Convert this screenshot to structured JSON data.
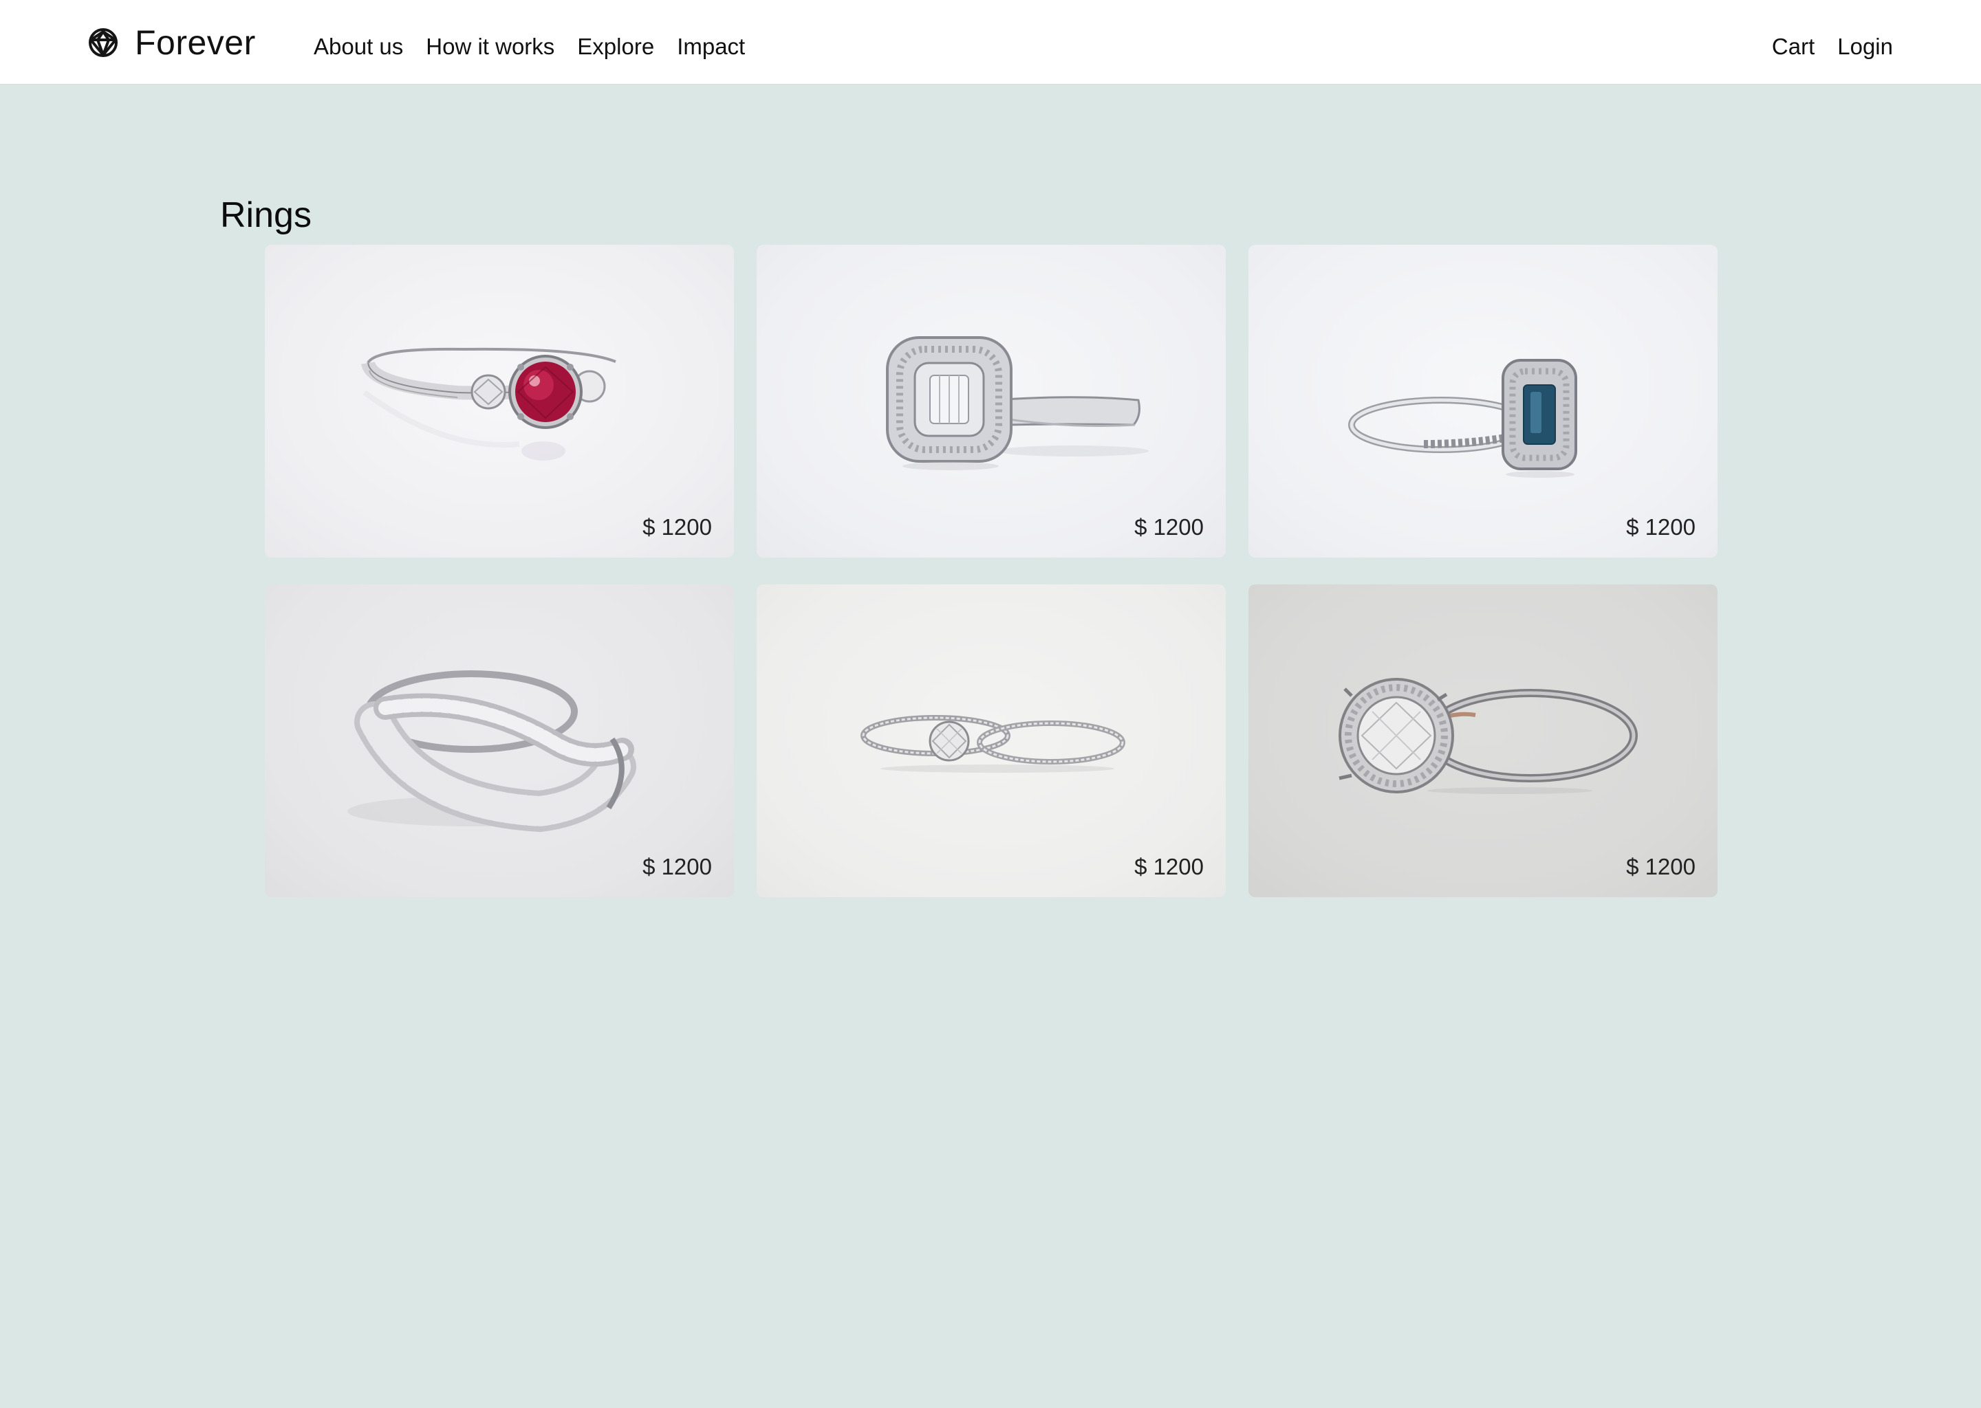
{
  "header": {
    "brand": {
      "name": "Forever",
      "icon": "diamond-icon"
    },
    "nav_left": [
      {
        "label": "About us"
      },
      {
        "label": "How it works"
      },
      {
        "label": "Explore"
      },
      {
        "label": "Impact"
      }
    ],
    "nav_right": [
      {
        "label": "Cart"
      },
      {
        "label": "Login"
      }
    ]
  },
  "main": {
    "section_title": "Rings",
    "products": [
      {
        "price": "$ 1200",
        "image": "ruby-three-stone-ring"
      },
      {
        "price": "$ 1200",
        "image": "cushion-halo-diamond-ring"
      },
      {
        "price": "$ 1200",
        "image": "sapphire-emerald-cut-halo-ring"
      },
      {
        "price": "$ 1200",
        "image": "crossover-pave-band-ring"
      },
      {
        "price": "$ 1200",
        "image": "solitaire-bridal-set"
      },
      {
        "price": "$ 1200",
        "image": "round-halo-engagement-ring"
      }
    ]
  },
  "colors": {
    "page_background": "#dae7e4",
    "header_background": "#ffffff",
    "text": "#111111",
    "ruby": "#a3123a",
    "sapphire": "#23506a"
  }
}
